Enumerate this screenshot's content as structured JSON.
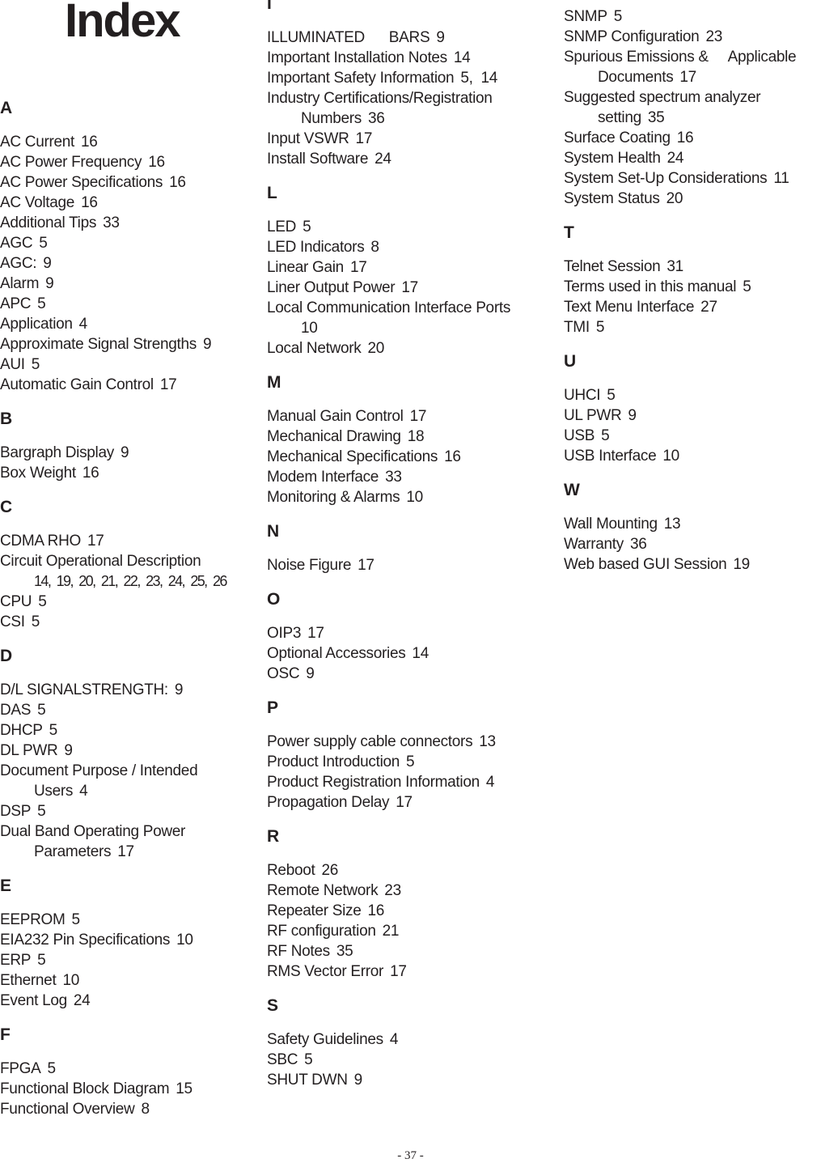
{
  "title": "Index",
  "columns": [
    {
      "sections": [
        {
          "letter": "A",
          "entries": [
            {
              "term": "AC Current",
              "pages": "16"
            },
            {
              "term": "AC Power Frequency",
              "pages": "16"
            },
            {
              "term": "AC Power Specifications",
              "pages": "16"
            },
            {
              "term": "AC Voltage",
              "pages": "16"
            },
            {
              "term": "Additional Tips",
              "pages": "33"
            },
            {
              "term": "AGC",
              "pages": "5"
            },
            {
              "term": "AGC:",
              "pages": "9"
            },
            {
              "term": "Alarm",
              "pages": "9"
            },
            {
              "term": "APC",
              "pages": "5"
            },
            {
              "term": "Application",
              "pages": "4"
            },
            {
              "term": "Approximate Signal Strengths",
              "pages": "9"
            },
            {
              "term": "AUI",
              "pages": "5"
            },
            {
              "term": "Automatic Gain Control",
              "pages": "17"
            }
          ]
        },
        {
          "letter": "B",
          "entries": [
            {
              "term": "Bargraph Display",
              "pages": "9"
            },
            {
              "term": "Box Weight",
              "pages": "16"
            }
          ]
        },
        {
          "letter": "C",
          "entries": [
            {
              "term": "CDMA RHO",
              "pages": "17"
            },
            {
              "term": "Circuit Operational Description",
              "continuation": "",
              "pages": "14, 19, 20, 21, 22, 23, 24, 25, 26",
              "condensed": true
            },
            {
              "term": "CPU",
              "pages": "5"
            },
            {
              "term": "CSI",
              "pages": "5"
            }
          ]
        },
        {
          "letter": "D",
          "entries": [
            {
              "term": "D/L SIGNALSTRENGTH:",
              "pages": "9"
            },
            {
              "term": "DAS",
              "pages": "5"
            },
            {
              "term": "DHCP",
              "pages": "5"
            },
            {
              "term": "DL PWR",
              "pages": "9"
            },
            {
              "term": "Document Purpose / Intended",
              "continuation": "Users",
              "pages": "4"
            },
            {
              "term": "DSP",
              "pages": "5"
            },
            {
              "term": "Dual Band Operating Power",
              "continuation": "Parameters",
              "pages": "17"
            }
          ]
        },
        {
          "letter": "E",
          "entries": [
            {
              "term": "EEPROM",
              "pages": "5"
            },
            {
              "term": "EIA232 Pin Specifications",
              "pages": "10"
            },
            {
              "term": "ERP",
              "pages": "5"
            },
            {
              "term": "Ethernet",
              "pages": "10"
            },
            {
              "term": "Event Log",
              "pages": "24"
            }
          ]
        },
        {
          "letter": "F",
          "entries": [
            {
              "term": "FPGA",
              "pages": "5"
            },
            {
              "term": "Functional Block Diagram",
              "pages": "15"
            },
            {
              "term": "Functional Overview",
              "pages": "8"
            }
          ]
        }
      ]
    },
    {
      "sections": [
        {
          "letter": "I",
          "entries": [
            {
              "term": "ILLUMINATED      BARS",
              "pages": "9"
            },
            {
              "term": "Important Installation Notes",
              "pages": "14"
            },
            {
              "term": "Important Safety Information",
              "pages": "5,  14"
            },
            {
              "term": "Industry Certifications/Registration",
              "continuation": "Numbers",
              "pages": "36"
            },
            {
              "term": "Input VSWR",
              "pages": "17"
            },
            {
              "term": "Install Software",
              "pages": "24"
            }
          ]
        },
        {
          "letter": "L",
          "entries": [
            {
              "term": "LED",
              "pages": "5"
            },
            {
              "term": "LED Indicators",
              "pages": "8"
            },
            {
              "term": "Linear Gain",
              "pages": "17"
            },
            {
              "term": "Liner Output Power",
              "pages": "17"
            },
            {
              "term": "Local Communication Interface Ports",
              "continuation": "",
              "pages": "10"
            },
            {
              "term": "Local Network",
              "pages": "20"
            }
          ]
        },
        {
          "letter": "M",
          "entries": [
            {
              "term": "Manual Gain Control",
              "pages": "17"
            },
            {
              "term": "Mechanical Drawing",
              "pages": "18"
            },
            {
              "term": "Mechanical Specifications",
              "pages": "16"
            },
            {
              "term": "Modem Interface",
              "pages": "33"
            },
            {
              "term": "Monitoring & Alarms",
              "pages": "10"
            }
          ]
        },
        {
          "letter": "N",
          "entries": [
            {
              "term": "Noise Figure",
              "pages": "17"
            }
          ]
        },
        {
          "letter": "O",
          "entries": [
            {
              "term": "OIP3",
              "pages": "17"
            },
            {
              "term": "Optional Accessories",
              "pages": "14"
            },
            {
              "term": "OSC",
              "pages": "9"
            }
          ]
        },
        {
          "letter": "P",
          "entries": [
            {
              "term": "Power supply cable connectors",
              "pages": "13"
            },
            {
              "term": "Product Introduction",
              "pages": "5"
            },
            {
              "term": "Product Registration Information",
              "pages": "4"
            },
            {
              "term": "Propagation Delay",
              "pages": "17"
            }
          ]
        },
        {
          "letter": "R",
          "entries": [
            {
              "term": "Reboot",
              "pages": "26"
            },
            {
              "term": "Remote Network",
              "pages": "23"
            },
            {
              "term": "Repeater Size",
              "pages": "16"
            },
            {
              "term": "RF configuration",
              "pages": "21"
            },
            {
              "term": "RF Notes",
              "pages": "35"
            },
            {
              "term": "RMS Vector Error",
              "pages": "17"
            }
          ]
        },
        {
          "letter": "S",
          "entries": [
            {
              "term": "Safety Guidelines",
              "pages": "4"
            },
            {
              "term": "SBC",
              "pages": "5"
            },
            {
              "term": "SHUT DWN",
              "pages": "9"
            }
          ]
        }
      ]
    },
    {
      "sections": [
        {
          "letter": "",
          "entries": [
            {
              "term": "SNMP",
              "pages": "5"
            },
            {
              "term": "SNMP Configuration",
              "pages": "23"
            },
            {
              "term": "Spurious Emissions &     Applicable",
              "continuation": "Documents",
              "pages": "17"
            },
            {
              "term": "Suggested spectrum analyzer",
              "continuation": "setting",
              "pages": "35"
            },
            {
              "term": "Surface Coating",
              "pages": "16"
            },
            {
              "term": "System Health",
              "pages": "24"
            },
            {
              "term": "System Set-Up Considerations",
              "pages": "11"
            },
            {
              "term": "System Status",
              "pages": "20"
            }
          ]
        },
        {
          "letter": "T",
          "entries": [
            {
              "term": "Telnet Session",
              "pages": "31"
            },
            {
              "term": "Terms used in this manual",
              "pages": "5"
            },
            {
              "term": "Text Menu Interface",
              "pages": "27"
            },
            {
              "term": "TMI",
              "pages": "5"
            }
          ]
        },
        {
          "letter": "U",
          "entries": [
            {
              "term": "UHCI",
              "pages": "5"
            },
            {
              "term": "UL PWR",
              "pages": "9"
            },
            {
              "term": "USB",
              "pages": "5"
            },
            {
              "term": "USB Interface",
              "pages": "10"
            }
          ]
        },
        {
          "letter": "W",
          "entries": [
            {
              "term": "Wall Mounting",
              "pages": "13"
            },
            {
              "term": "Warranty",
              "pages": "36"
            },
            {
              "term": "Web based GUI Session",
              "pages": "19"
            }
          ]
        }
      ]
    }
  ],
  "footer": {
    "page_number": "- 37 -"
  }
}
